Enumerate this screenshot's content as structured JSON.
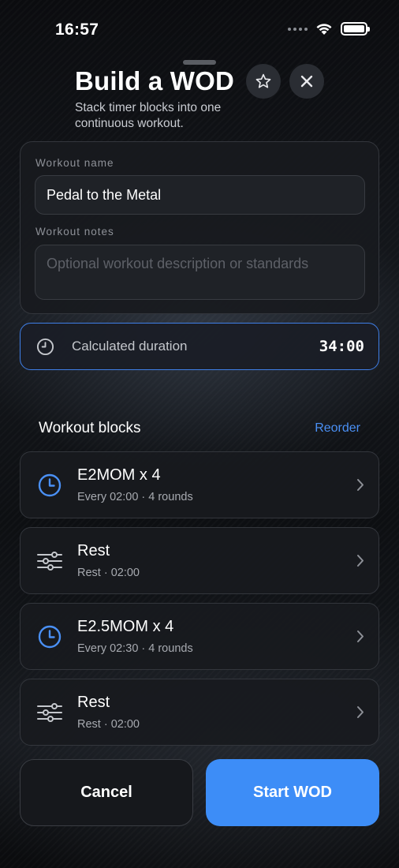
{
  "status_bar": {
    "time": "16:57"
  },
  "header": {
    "title": "Build a WOD",
    "subtitle": "Stack timer blocks into one continuous workout.",
    "star_icon": "star-icon",
    "close_icon": "close-icon"
  },
  "form": {
    "name_label": "Workout name",
    "name_value": "Pedal to the Metal",
    "notes_label": "Workout notes",
    "notes_placeholder": "Optional workout description or standards"
  },
  "duration": {
    "label": "Calculated duration",
    "value": "34:00",
    "icon": "clock-icon"
  },
  "blocks_section": {
    "title": "Workout blocks",
    "reorder_label": "Reorder"
  },
  "blocks": [
    {
      "name": "E2MOM x 4",
      "detail": "Every 02:00 · 4 rounds",
      "icon": "timer-icon"
    },
    {
      "name": "Rest",
      "detail": "Rest · 02:00",
      "icon": "sliders-icon"
    },
    {
      "name": "E2.5MOM x 4",
      "detail": "Every 02:30 · 4 rounds",
      "icon": "timer-icon"
    },
    {
      "name": "Rest",
      "detail": "Rest · 02:00",
      "icon": "sliders-icon"
    }
  ],
  "actions": {
    "cancel_label": "Cancel",
    "start_label": "Start WOD"
  },
  "colors": {
    "accent": "#3d8df7",
    "link": "#4a90f5",
    "background": "#08090b"
  }
}
